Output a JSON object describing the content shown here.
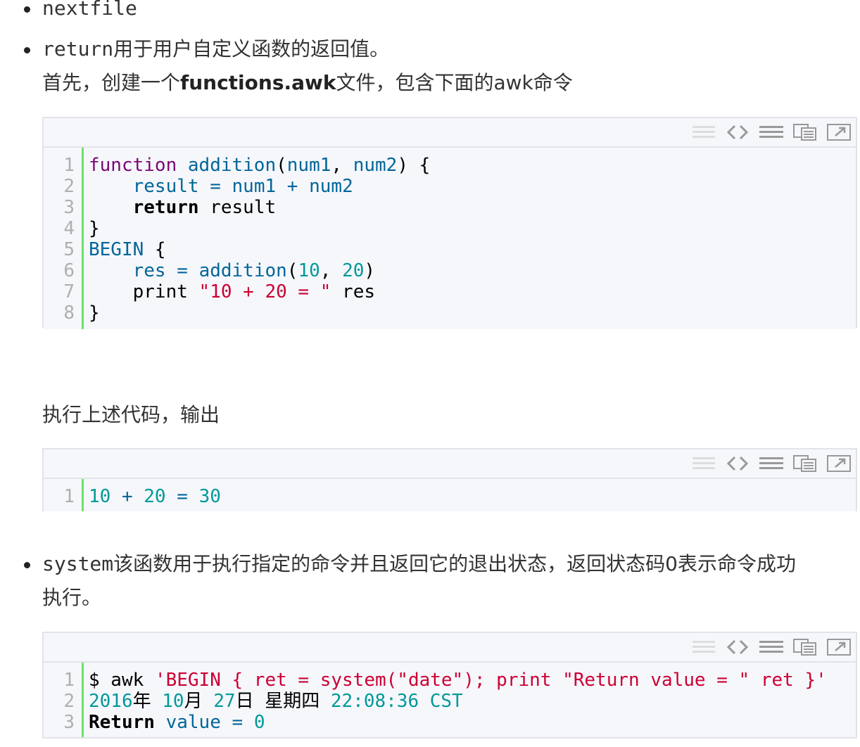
{
  "items": {
    "nextfile": "nextfile",
    "return_word": "return",
    "return_desc": "用于用户自定义函数的返回值。",
    "intro_prefix": "首先，创建一个",
    "intro_file": "functions.awk",
    "intro_suffix": "文件，包含下面的awk命令",
    "exec_text": "执行上述代码，输出",
    "system_word": "system",
    "system_desc_1": "该函数用于执行指定的命令并且返回它的退出状态，返回状态码0表示命令成功",
    "system_desc_2": "执行。"
  },
  "toolbar_icons": [
    "list-icon",
    "code-icon",
    "wrap-icon",
    "copy-icon",
    "expand-icon"
  ],
  "code1": {
    "line_numbers": [
      "1",
      "2",
      "3",
      "4",
      "5",
      "6",
      "7",
      "8"
    ],
    "l1_a": "function",
    "l1_b": " ",
    "l1_c": "addition",
    "l1_d": "(",
    "l1_e": "num1",
    "l1_f": ", ",
    "l1_g": "num2",
    "l1_h": ") {",
    "l2_a": "    ",
    "l2_b": "result",
    "l2_c": " = ",
    "l2_d": "num1",
    "l2_e": " + ",
    "l2_f": "num2",
    "l3_a": "    ",
    "l3_b": "return",
    "l3_c": " result",
    "l4": "}",
    "l5_a": "BEGIN",
    "l5_b": " {",
    "l6_a": "    ",
    "l6_b": "res",
    "l6_c": " = ",
    "l6_d": "addition",
    "l6_e": "(",
    "l6_f": "10",
    "l6_g": ", ",
    "l6_h": "20",
    "l6_i": ")",
    "l7_a": "    print ",
    "l7_b": "\"10 + 20 = \"",
    "l7_c": " res",
    "l8": "}"
  },
  "code2": {
    "line_numbers": [
      "1"
    ],
    "l1_a": "10",
    "l1_b": " + ",
    "l1_c": "20",
    "l1_d": " = ",
    "l1_e": "30"
  },
  "code3": {
    "line_numbers": [
      "1",
      "2",
      "3"
    ],
    "l1_a": "$ awk ",
    "l1_b": "'BEGIN { ret = system(\"date\"); print \"Return value = \" ret }'",
    "l2_a": "2016",
    "l2_b": "年 ",
    "l2_c": "10",
    "l2_d": "月 ",
    "l2_e": "27",
    "l2_f": "日 星期四 ",
    "l2_g": "22:08:36 CST",
    "l3_a": "Return",
    "l3_b": " ",
    "l3_c": "value",
    "l3_d": " = ",
    "l3_e": "0"
  }
}
